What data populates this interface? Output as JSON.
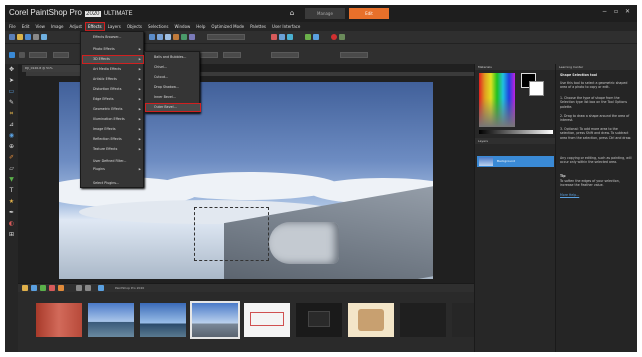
{
  "window": {
    "title": "Corel PaintShop Pro",
    "version_badge": "2020",
    "edition": "ULTIMATE",
    "minimize": "−",
    "maximize": "▫",
    "close": "✕"
  },
  "workspace_tabs": {
    "home": "⌂",
    "manage": "Manage",
    "edit": "Edit"
  },
  "menubar": {
    "items": [
      "File",
      "Edit",
      "View",
      "Image",
      "Adjust",
      "Effects",
      "Layers",
      "Objects",
      "Selections",
      "Window",
      "Help",
      "Optimized Mode",
      "Palettes",
      "User Interface"
    ]
  },
  "document": {
    "tab_label": "DJI_0126-8 @ 51%"
  },
  "effects_menu": {
    "items": [
      "Effects Browser...",
      "Photo Effects",
      "3D Effects",
      "Art Media Effects",
      "Artistic Effects",
      "Distortion Effects",
      "Edge Effects",
      "Geometric Effects",
      "Illumination Effects",
      "Image Effects",
      "Reflection Effects",
      "Texture Effects",
      "User Defined Filter...",
      "Plugins",
      "",
      "Select Plugins..."
    ]
  },
  "submenu_3d": {
    "items": [
      "Balls and Bubbles...",
      "Chisel...",
      "Cutout...",
      "Drop Shadow...",
      "Inner Bevel...",
      "Outer Bevel..."
    ]
  },
  "organizer": {
    "label": "PaintShop Pro 2020"
  },
  "materials": {
    "title": "Materials"
  },
  "layers": {
    "title": "Layers",
    "layer_name": "Background"
  },
  "learning_center": {
    "title": "Learning Center",
    "heading": "Shape Selection tool",
    "intro": "Use this tool to select a geometric shaped area of a photo to copy or edit.",
    "steps": [
      "1. Choose the type of shape from the Selection type list box on the Tool Options palette.",
      "2. Drag to draw a shape around the area of interest.",
      "3. Optional: To add more area to the selection, press Shift and draw. To subtract area from the selection, press Ctrl and draw."
    ],
    "note": "Any copying or editing, such as painting, will occur only within the selected area.",
    "tip_label": "Tip",
    "tip": "To soften the edges of your selection, increase the Feather value.",
    "more_link": "More Help..."
  },
  "colors": {
    "accent": "#e8702a",
    "highlight": "#d02020",
    "panel": "#272727",
    "selection": "#3a8ad6"
  }
}
